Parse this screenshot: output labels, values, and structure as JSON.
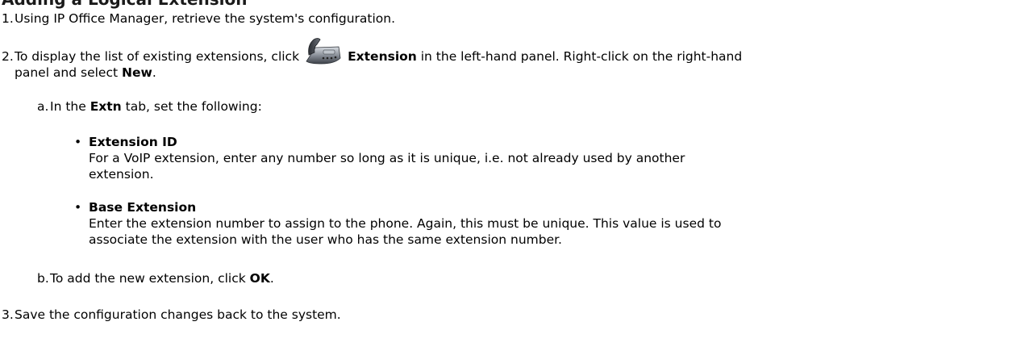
{
  "heading": "Adding a Logical Extension",
  "steps": {
    "s1": {
      "num": "1.",
      "text": "Using IP Office Manager, retrieve the system's configuration."
    },
    "s2": {
      "num": "2.",
      "pre": "To display the list of existing extensions, click",
      "icon": "phone-icon",
      "bold1": "Extension",
      "mid": " in the left-hand panel. Right-click on the right-hand",
      "line2_pre": "panel and select ",
      "bold2": "New",
      "line2_post": ".",
      "sub_a": {
        "num": "a.",
        "pre": "In the ",
        "bold": "Extn",
        "post": " tab, set the following:",
        "bullets": [
          {
            "title": "Extension ID",
            "line1": "For a VoIP extension, enter any number so long as it is unique, i.e. not already used by another",
            "line2": "extension."
          },
          {
            "title": "Base Extension",
            "line1": "Enter the extension number to assign to the phone. Again, this must be unique. This value is used to",
            "line2": "associate the extension with the user who has the same extension number."
          }
        ]
      },
      "sub_b": {
        "num": "b.",
        "pre": "To add the new extension, click ",
        "bold": "OK",
        "post": "."
      }
    },
    "s3": {
      "num": "3.",
      "text": "Save the configuration changes back to the system."
    }
  }
}
